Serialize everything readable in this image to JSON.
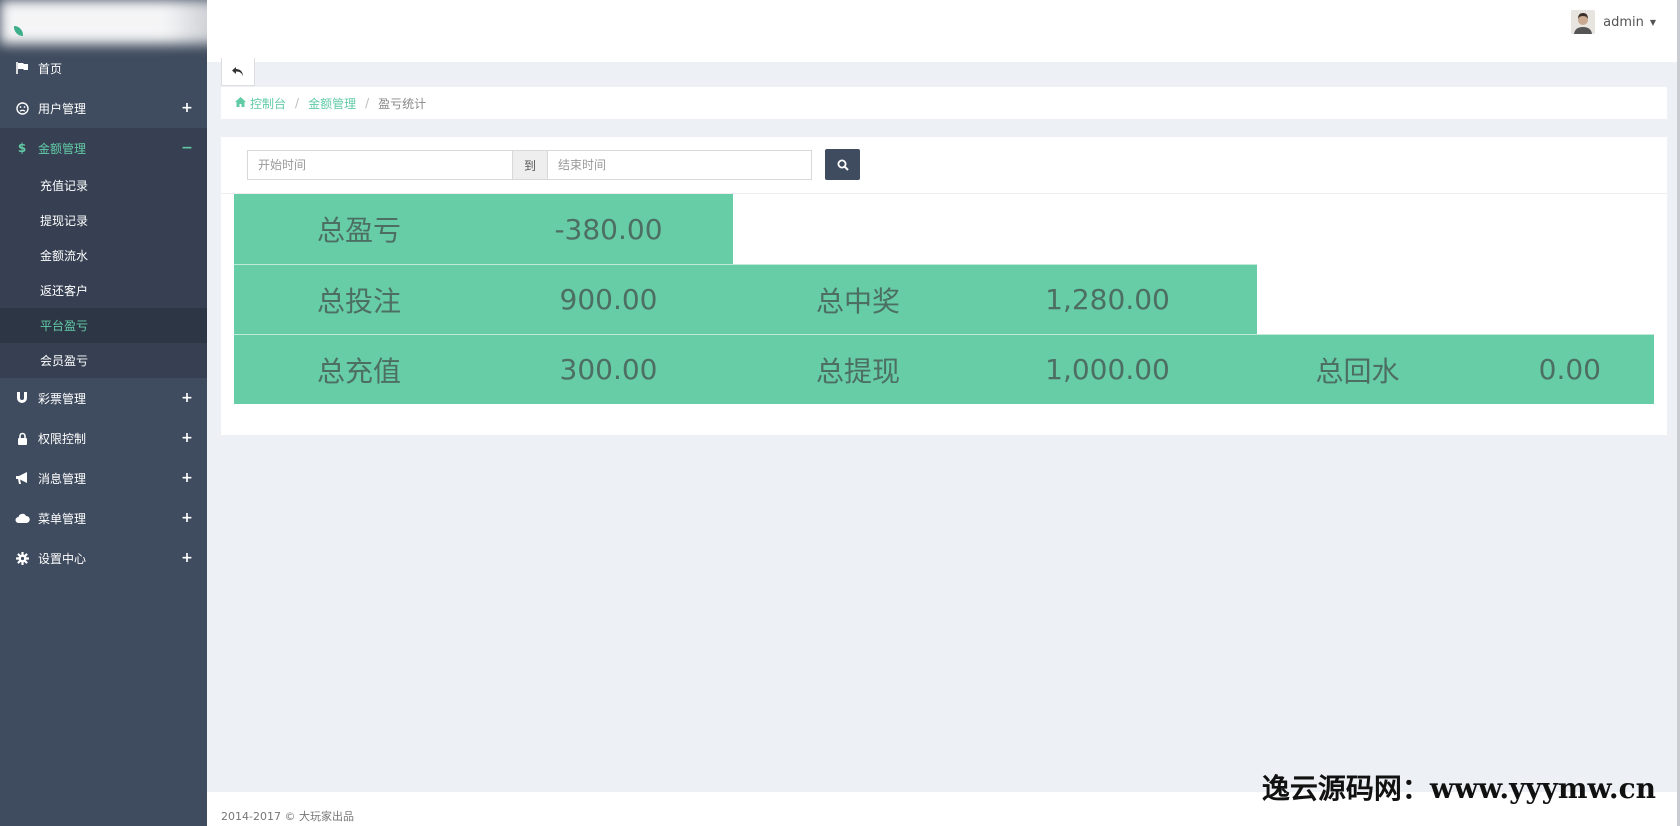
{
  "sidebar": {
    "items": [
      {
        "label": "首页",
        "icon": "flag-icon"
      },
      {
        "label": "用户管理",
        "icon": "smile-icon",
        "toggle": "+"
      },
      {
        "label": "金额管理",
        "icon": "dollar-icon",
        "toggle": "−"
      },
      {
        "label": "彩票管理",
        "icon": "magnet-icon",
        "toggle": "+"
      },
      {
        "label": "权限控制",
        "icon": "lock-icon",
        "toggle": "+"
      },
      {
        "label": "消息管理",
        "icon": "bullhorn-icon",
        "toggle": "+"
      },
      {
        "label": "菜单管理",
        "icon": "cloud-icon",
        "toggle": "+"
      },
      {
        "label": "设置中心",
        "icon": "gear-icon",
        "toggle": "+"
      }
    ],
    "money_sub": [
      "充值记录",
      "提现记录",
      "金额流水",
      "返还客户",
      "平台盈亏",
      "会员盈亏"
    ]
  },
  "header": {
    "username": "admin"
  },
  "breadcrumb": {
    "items": [
      "控制台",
      "金额管理",
      "盈亏统计"
    ]
  },
  "filter": {
    "start_placeholder": "开始时间",
    "to_label": "到",
    "end_placeholder": "结束时间"
  },
  "stats": {
    "total_profit_label": "总盈亏",
    "total_profit": "-380.00",
    "total_bet_label": "总投注",
    "total_bet": "900.00",
    "total_win_label": "总中奖",
    "total_win": "1,280.00",
    "total_recharge_label": "总充值",
    "total_recharge": "300.00",
    "total_withdraw_label": "总提现",
    "total_withdraw": "1,000.00",
    "total_rebate_label": "总回水",
    "total_rebate": "0.00"
  },
  "footer": {
    "copyright": "2014-2017 © 大玩家出品"
  },
  "watermark": "逸云源码网：www.yyymw.cn",
  "colors": {
    "sidebar": "#3f4b5e",
    "accent": "#62cba6",
    "stat_bg": "#66cda7"
  }
}
